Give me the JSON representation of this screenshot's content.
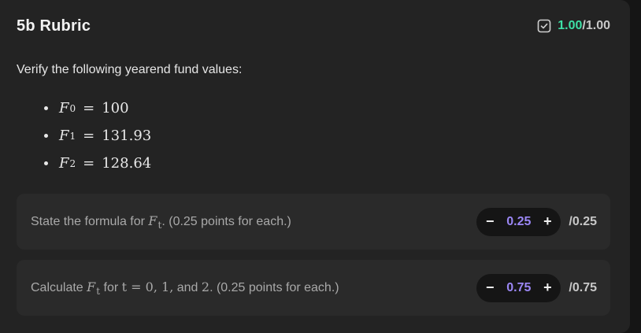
{
  "rubric": {
    "title": "5b Rubric",
    "score_earned": "1.00",
    "score_total": "/1.00",
    "check_icon": "check-square-icon",
    "accent_color": "#3ee0a6"
  },
  "intro_text": "Verify the following yearend fund values:",
  "funds": [
    {
      "symbol": "F",
      "sub": "0",
      "eq": "=",
      "value": "100"
    },
    {
      "symbol": "F",
      "sub": "1",
      "eq": "=",
      "value": "131.93"
    },
    {
      "symbol": "F",
      "sub": "2",
      "eq": "=",
      "value": "128.64"
    }
  ],
  "criteria": [
    {
      "text_before": "State the formula for ",
      "math": "F",
      "math_sub": "t",
      "text_after": ". (0.25 points for each.)",
      "minus": "−",
      "value": "0.25",
      "plus": "+",
      "max": "/0.25"
    },
    {
      "text_before": "Calculate ",
      "math": "F",
      "math_sub": "t",
      "text_mid": " for ",
      "math2": "t = 0, 1,",
      "text_mid2": " and ",
      "math3": "2",
      "text_after": ". (0.25 points for each.)",
      "minus": "−",
      "value": "0.75",
      "plus": "+",
      "max": "/0.75"
    }
  ],
  "value_color": "#9b87f5"
}
